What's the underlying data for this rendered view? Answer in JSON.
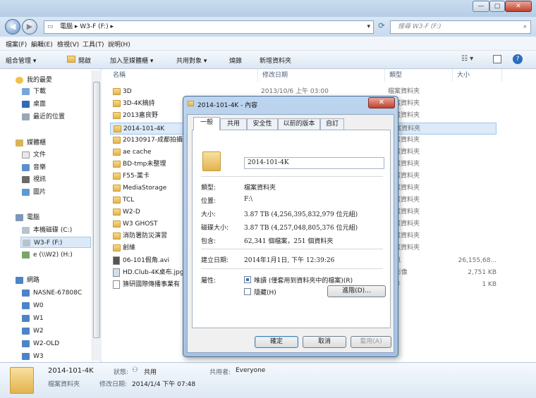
{
  "window": {
    "min_glyph": "—",
    "max_glyph": "▢",
    "close_glyph": "✕",
    "address_path": "電腦 ▸ W3-F (F:) ▸",
    "search_placeholder": "搜尋 W3-F (F:)"
  },
  "menu": [
    "檔案(F)",
    "編輯(E)",
    "檢視(V)",
    "工具(T)",
    "說明(H)"
  ],
  "toolbar": {
    "organize": "組合管理 ▾",
    "open": "開啟",
    "include": "加入至媒體櫃 ▾",
    "share": "共用對象 ▾",
    "burn": "燒錄",
    "new_folder": "新增資料夾"
  },
  "nav": {
    "favorites": "我的最愛",
    "downloads": "下載",
    "desktop": "桌面",
    "recent": "最近的位置",
    "libraries": "媒體櫃",
    "documents": "文件",
    "music": "音樂",
    "videos": "視訊",
    "pictures": "圖片",
    "computer": "電腦",
    "local_c": "本機磁碟 (C:)",
    "w3f": "W3-F (F:)",
    "net_e": "e (\\\\W2) (H:)",
    "network": "網路",
    "hosts": [
      "NASNE-67808C",
      "W0",
      "W1",
      "W2",
      "W2-OLD",
      "W3"
    ]
  },
  "columns": {
    "name": "名稱",
    "date": "修改日期",
    "type": "類型",
    "size": "大小"
  },
  "files": [
    {
      "name": "3D",
      "date": "2013/10/6 上午 03:00",
      "type": "檔案資料夾",
      "size": ""
    },
    {
      "name": "3D-4K摘詩",
      "date": "",
      "type": "檔案資料夾",
      "size": ""
    },
    {
      "name": "2013嘉良野",
      "date": "",
      "type": "檔案資料夾",
      "size": ""
    },
    {
      "name": "2014-101-4K",
      "date": "",
      "type": "檔案資料夾",
      "size": ""
    },
    {
      "name": "20130917-成都拍攝",
      "date": "",
      "type": "檔案資料夾",
      "size": ""
    },
    {
      "name": "ae cache",
      "date": "",
      "type": "檔案資料夾",
      "size": ""
    },
    {
      "name": "BD-tmp未整理",
      "date": "",
      "type": "檔案資料夾",
      "size": ""
    },
    {
      "name": "F55-黨卡",
      "date": "",
      "type": "檔案資料夾",
      "size": ""
    },
    {
      "name": "MediaStorage",
      "date": "",
      "type": "檔案資料夾",
      "size": ""
    },
    {
      "name": "TCL",
      "date": "",
      "type": "檔案資料夾",
      "size": ""
    },
    {
      "name": "W2-D",
      "date": "",
      "type": "檔案資料夾",
      "size": ""
    },
    {
      "name": "W3 GHOST",
      "date": "",
      "type": "檔案資料夾",
      "size": ""
    },
    {
      "name": "消防署防災演習",
      "date": "",
      "type": "檔案資料夾",
      "size": ""
    },
    {
      "name": "創維",
      "date": "",
      "type": "檔案資料夾",
      "size": ""
    },
    {
      "name": "06-101假角.avi",
      "date": "",
      "type": "視訊",
      "size": "26,155,68..."
    },
    {
      "name": "HD.Club-4K桌布.jpg",
      "date": "",
      "type": "G 影像",
      "size": "2,751 KB"
    },
    {
      "name": "猜研國際傳播事業有",
      "date": "",
      "type": "文件",
      "size": "1 KB"
    }
  ],
  "status": {
    "name": "2014-101-4K",
    "type": "檔案資料夾",
    "state_label": "狀態:",
    "state_value": "共用",
    "modified_label": "修改日期:",
    "modified_value": "2014/1/4 下午 07:48",
    "shared_label": "共用者:",
    "shared_value": "Everyone"
  },
  "dialog": {
    "title": "2014-101-4K - 內容",
    "tabs": [
      "一般",
      "共用",
      "安全性",
      "以前的版本",
      "自訂"
    ],
    "folder_name": "2014-101-4K",
    "type_label": "類型:",
    "type_value": "檔案資料夾",
    "location_label": "位置:",
    "location_value": "F:\\",
    "size_label": "大小:",
    "size_value": "3.87 TB (4,256,395,832,979 位元組)",
    "disk_label": "磁碟大小:",
    "disk_value": "3.87 TB (4,257,048,805,376 位元組)",
    "contains_label": "包含:",
    "contains_value": "62,341 個檔案，251 個資料夾",
    "created_label": "建立日期:",
    "created_value": "2014年1月1日, 下午 12:39:26",
    "attr_label": "屬性:",
    "readonly_label": "唯讀 (僅套用到資料夾中的檔案)(R)",
    "hidden_label": "隱藏(H)",
    "advanced": "進階(D)...",
    "ok": "確定",
    "cancel": "取消",
    "apply": "套用(A)"
  }
}
